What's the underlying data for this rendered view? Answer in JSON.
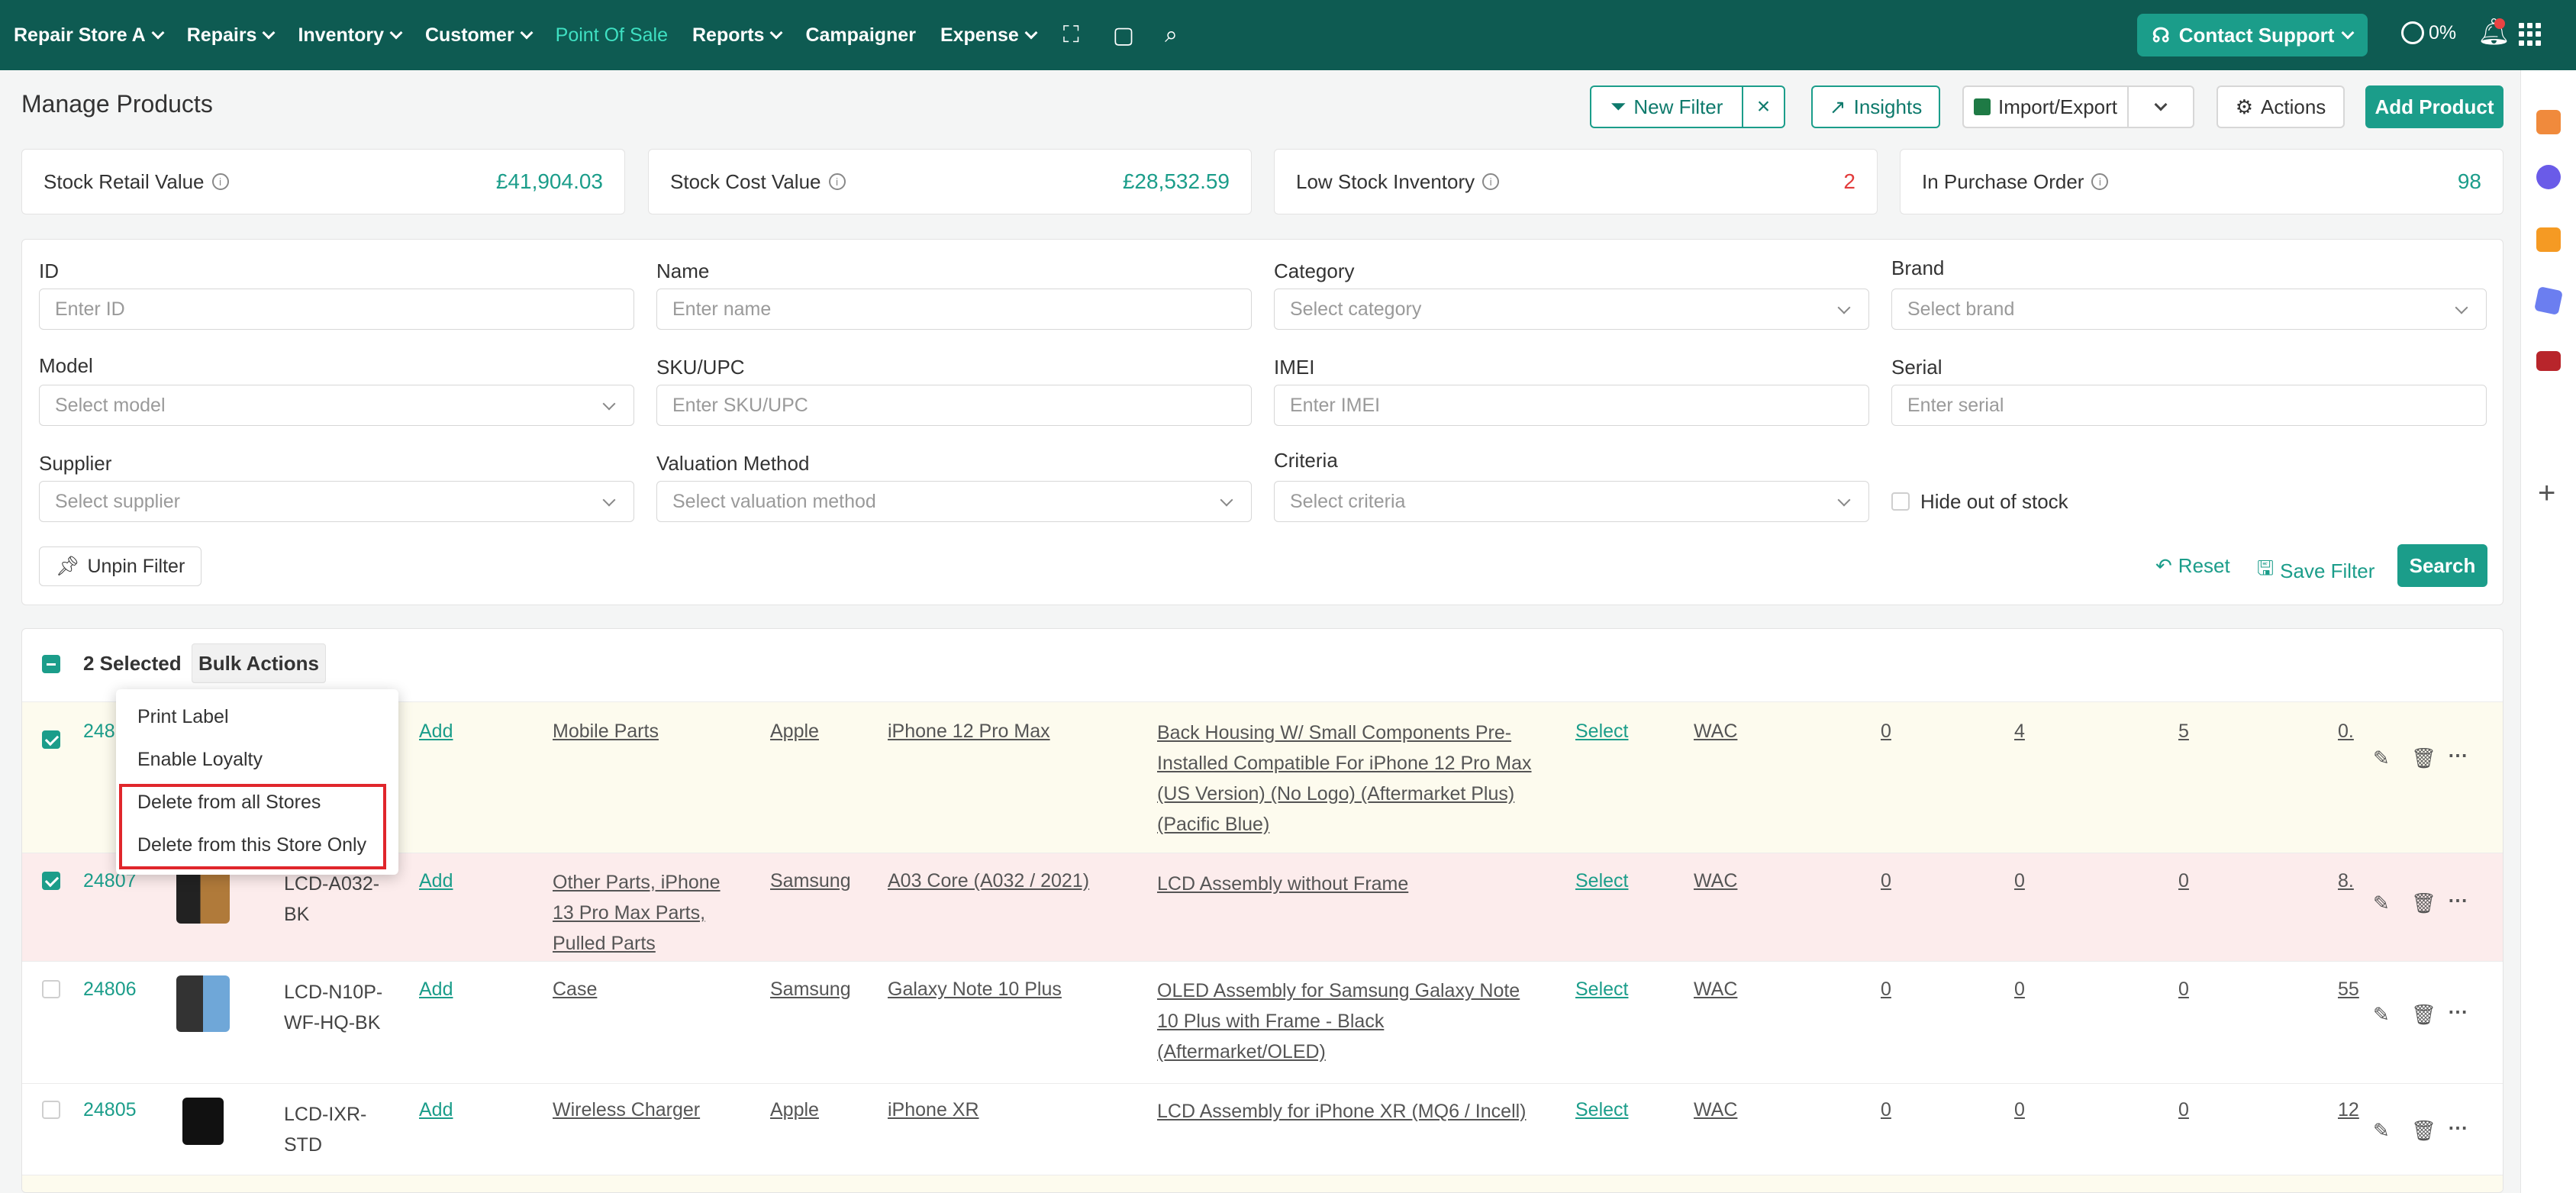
{
  "nav": {
    "store": "Repair Store A",
    "items": [
      "Repairs",
      "Inventory",
      "Customer"
    ],
    "pos": "Point Of Sale",
    "items2": [
      "Reports"
    ],
    "campaigner": "Campaigner",
    "expense": "Expense",
    "support": "Contact Support",
    "progress": "0%"
  },
  "header": {
    "title": "Manage Products",
    "new_filter": "New Filter",
    "insights": "Insights",
    "import_export": "Import/Export",
    "actions": "Actions",
    "add_product": "Add Product"
  },
  "stats": [
    {
      "label": "Stock Retail Value",
      "value": "£41,904.03"
    },
    {
      "label": "Stock Cost Value",
      "value": "£28,532.59"
    },
    {
      "label": "Low Stock Inventory",
      "value": "2"
    },
    {
      "label": "In Purchase Order",
      "value": "98"
    }
  ],
  "filters": {
    "id": {
      "label": "ID",
      "placeholder": "Enter ID"
    },
    "name": {
      "label": "Name",
      "placeholder": "Enter name"
    },
    "category": {
      "label": "Category",
      "placeholder": "Select category"
    },
    "brand": {
      "label": "Brand",
      "placeholder": "Select brand"
    },
    "model": {
      "label": "Model",
      "placeholder": "Select model"
    },
    "sku": {
      "label": "SKU/UPC",
      "placeholder": "Enter SKU/UPC"
    },
    "imei": {
      "label": "IMEI",
      "placeholder": "Enter IMEI"
    },
    "serial": {
      "label": "Serial",
      "placeholder": "Enter serial"
    },
    "supplier": {
      "label": "Supplier",
      "placeholder": "Select supplier"
    },
    "valuation": {
      "label": "Valuation Method",
      "placeholder": "Select valuation method"
    },
    "criteria": {
      "label": "Criteria",
      "placeholder": "Select criteria"
    },
    "hide_oos": "Hide out of stock",
    "unpin": "Unpin Filter",
    "reset": "Reset",
    "save": "Save Filter",
    "search": "Search"
  },
  "table": {
    "selected": "2 Selected",
    "bulk": "Bulk Actions",
    "rows": [
      {
        "id": "248",
        "sku": "",
        "add": "Add",
        "category": "Mobile Parts",
        "brand": "Apple",
        "model": "iPhone 12 Pro Max",
        "name_lines": [
          "Back Housing W/ Small Components Pre-",
          "Installed Compatible For iPhone 12 Pro Max",
          "(US Version) (No Logo) (Aftermarket Plus)",
          "(Pacific Blue)"
        ],
        "select": "Select",
        "method": "WAC",
        "n1": "0",
        "n2": "4",
        "n3": "5",
        "price": "0."
      },
      {
        "id": "24807",
        "sku_lines": [
          "LCD-A032-",
          "BK"
        ],
        "add": "Add",
        "category_lines": [
          "Other Parts, iPhone",
          "13 Pro Max Parts,",
          "Pulled Parts"
        ],
        "brand": "Samsung",
        "model": "A03 Core (A032 / 2021)",
        "name_lines": [
          "LCD Assembly without Frame"
        ],
        "select": "Select",
        "method": "WAC",
        "n1": "0",
        "n2": "0",
        "n3": "0",
        "price": "8."
      },
      {
        "id": "24806",
        "sku_lines": [
          "LCD-N10P-",
          "WF-HQ-BK"
        ],
        "add": "Add",
        "category": "Case",
        "brand": "Samsung",
        "model": "Galaxy Note 10 Plus",
        "name_lines": [
          "OLED Assembly for Samsung Galaxy Note",
          "10 Plus with Frame - Black",
          "(Aftermarket/OLED)"
        ],
        "select": "Select",
        "method": "WAC",
        "n1": "0",
        "n2": "0",
        "n3": "0",
        "price": "55"
      },
      {
        "id": "24805",
        "sku_lines": [
          "LCD-IXR-",
          "STD"
        ],
        "add": "Add",
        "category": "Wireless Charger",
        "brand": "Apple",
        "model": "iPhone XR",
        "name_lines": [
          "LCD Assembly for iPhone XR (MQ6 / Incell)"
        ],
        "select": "Select",
        "method": "WAC",
        "n1": "0",
        "n2": "0",
        "n3": "0",
        "price": "12"
      }
    ]
  },
  "menu": {
    "items": [
      "Print Label",
      "Enable Loyalty",
      "Delete from all Stores",
      "Delete from this Store Only"
    ]
  },
  "colors": {
    "brand": "#0e5b52",
    "accent": "#1b9d8a",
    "highlight": "#e0262b"
  }
}
